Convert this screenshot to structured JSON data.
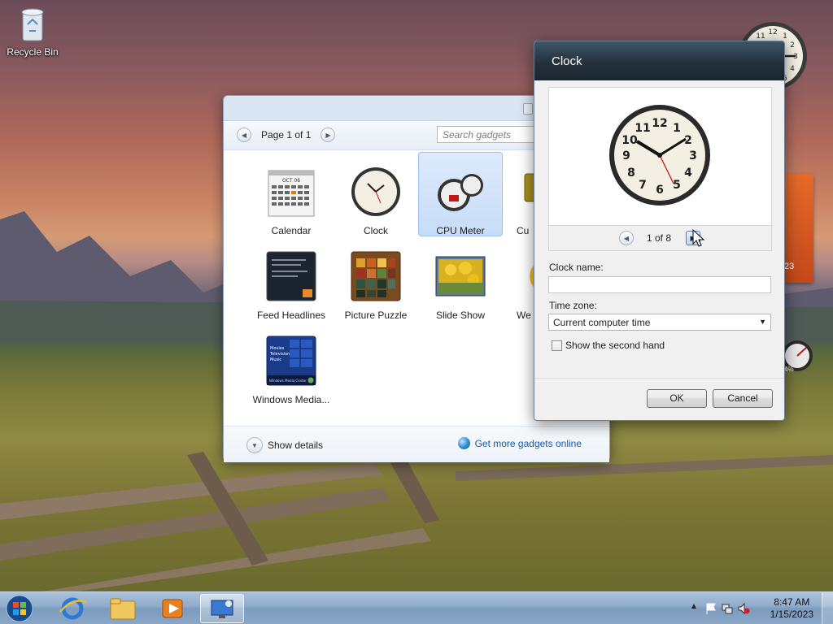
{
  "desktop": {
    "icons": [
      {
        "label": "Recycle Bin",
        "icon": "recycle-bin-icon"
      }
    ]
  },
  "gallery": {
    "pager": {
      "text": "Page 1 of 1"
    },
    "search": {
      "placeholder": "Search gadgets"
    },
    "gadgets": [
      {
        "name": "Calendar",
        "icon": "calendar-icon",
        "selected": false
      },
      {
        "name": "Clock",
        "icon": "clock-icon",
        "selected": false
      },
      {
        "name": "CPU Meter",
        "icon": "cpu-meter-icon",
        "selected": true
      },
      {
        "name": "Cu",
        "icon": "currency-icon",
        "selected": false
      },
      {
        "name": "Feed Headlines",
        "icon": "feed-headlines-icon",
        "selected": false
      },
      {
        "name": "Picture Puzzle",
        "icon": "picture-puzzle-icon",
        "selected": false
      },
      {
        "name": "Slide Show",
        "icon": "slide-show-icon",
        "selected": false
      },
      {
        "name": "We",
        "icon": "weather-icon",
        "selected": false
      },
      {
        "name": "Windows Media...",
        "icon": "windows-media-center-icon",
        "selected": false
      }
    ],
    "calendar_thumb_month": "OCT 06",
    "media_thumb_lines": [
      "Movies",
      "Television",
      "Music"
    ],
    "media_thumb_footer": "Windows Media Center",
    "footer": {
      "show_details": "Show details",
      "more_online": "Get more gadgets online"
    }
  },
  "clock_dialog": {
    "title": "Clock",
    "preview_counter": "1 of 8",
    "clock_name_label": "Clock name:",
    "clock_name_value": "",
    "time_zone_label": "Time zone:",
    "time_zone_value": "Current computer time",
    "second_hand_label": "Show the second hand",
    "second_hand_checked": false,
    "ok_label": "OK",
    "cancel_label": "Cancel"
  },
  "desk_gadgets": {
    "calendar_year": "23",
    "meter_percent": "4%"
  },
  "taskbar": {
    "time": "8:47 AM",
    "date": "1/15/2023",
    "pinned": [
      "start-orb-icon",
      "internet-explorer-icon",
      "file-explorer-icon",
      "media-player-icon",
      "desktop-gadgets-icon"
    ]
  },
  "colors": {
    "accent": "#1a5aa6",
    "selected_bg": "#c7dcf8",
    "dialog_title": "#23313c"
  }
}
